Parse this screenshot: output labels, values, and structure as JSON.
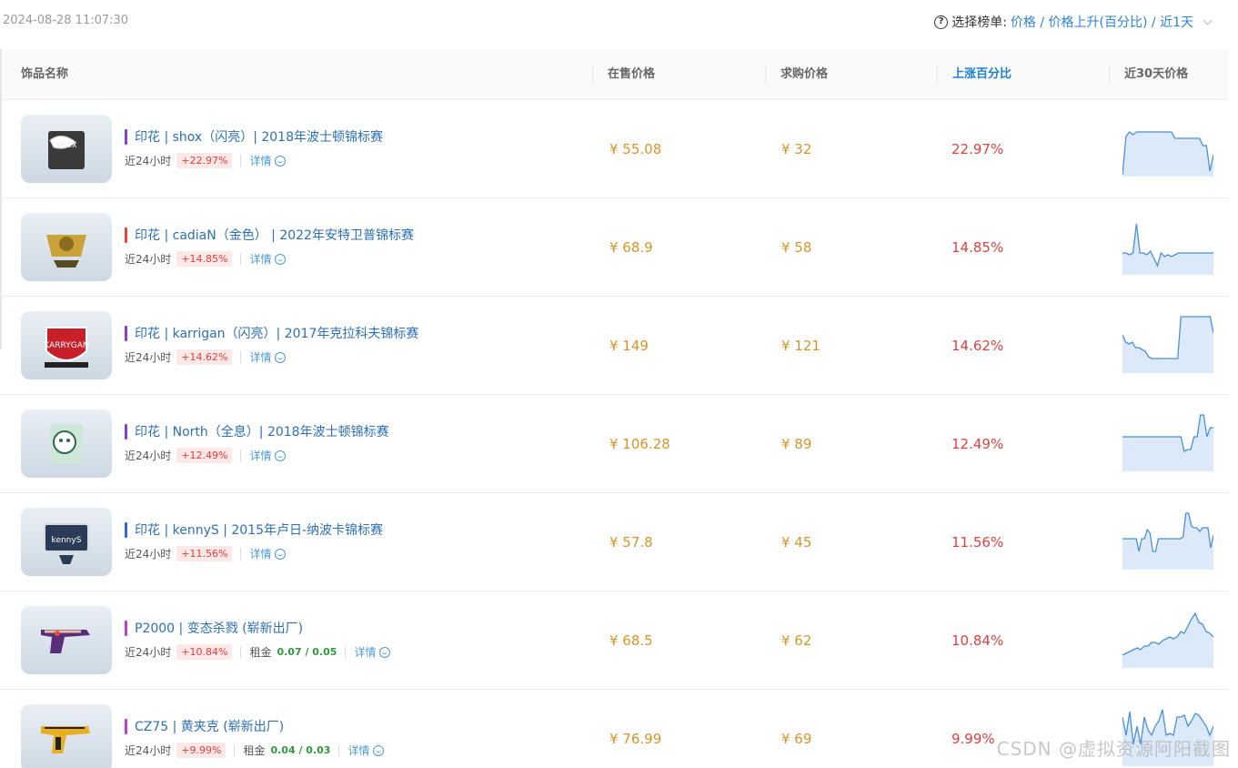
{
  "topbar": {
    "timestamp": "2024-08-28 11:07:30",
    "help_icon": "question-circle-icon",
    "rank_label": "选择榜单:",
    "rank_value": "价格 / 价格上升(百分比) / 近1天"
  },
  "table": {
    "headers": {
      "name": "饰品名称",
      "sell_price": "在售价格",
      "buy_price": "求购价格",
      "rise_pct": "上涨百分比",
      "trend": "近30天价格"
    },
    "period_label": "近24小时",
    "detail_label": "详情",
    "rent_label": "租金",
    "rows": [
      {
        "name": "印花 | shox（闪亮）| 2018年波士顿锦标赛",
        "bar_color": "#8a3fd1",
        "change": "+22.97%",
        "sell": "¥ 55.08",
        "buy": "¥ 32",
        "pct": "22.97%",
        "rent": "",
        "spark": [
          62,
          20,
          15,
          18,
          15,
          15,
          15,
          15,
          15,
          15,
          15,
          15,
          15,
          15,
          15,
          22,
          22,
          22,
          22,
          22,
          22,
          22,
          22,
          30,
          30,
          58,
          40
        ],
        "thumb": "sticker-shox"
      },
      {
        "name": "印花 | cadiaN（金色） | 2022年安特卫普锦标赛",
        "bar_color": "#e04a3a",
        "change": "+14.85%",
        "sell": "¥ 68.9",
        "buy": "¥ 58",
        "pct": "14.85%",
        "rent": "",
        "spark": [
          40,
          40,
          42,
          40,
          8,
          40,
          40,
          42,
          38,
          46,
          54,
          40,
          44,
          42,
          44,
          42,
          40,
          40,
          40,
          40,
          40,
          40,
          40,
          40,
          40,
          40,
          40
        ],
        "thumb": "sticker-cadian"
      },
      {
        "name": "印花 | karrigan（闪亮）| 2017年克拉科夫锦标赛",
        "bar_color": "#8a3fd1",
        "change": "+14.62%",
        "sell": "¥ 149",
        "buy": "¥ 121",
        "pct": "14.62%",
        "rent": "",
        "spark": [
          22,
          30,
          32,
          30,
          36,
          36,
          38,
          40,
          46,
          48,
          48,
          48,
          48,
          48,
          48,
          48,
          48,
          48,
          2,
          2,
          2,
          2,
          2,
          2,
          2,
          2,
          2,
          2,
          20
        ],
        "thumb": "sticker-karrigan"
      },
      {
        "name": "印花 | North（全息）| 2018年波士顿锦标赛",
        "bar_color": "#8a3fd1",
        "change": "+12.49%",
        "sell": "¥ 106.28",
        "buy": "¥ 89",
        "pct": "12.49%",
        "rent": "",
        "spark": [
          26,
          26,
          26,
          26,
          26,
          26,
          26,
          26,
          26,
          26,
          26,
          26,
          26,
          26,
          26,
          26,
          26,
          26,
          26,
          42,
          40,
          40,
          26,
          26,
          2,
          2,
          26,
          16,
          16
        ],
        "thumb": "sticker-north"
      },
      {
        "name": "印花 | kennyS | 2015年卢日-纳波卡锦标赛",
        "bar_color": "#3466d8",
        "change": "+11.56%",
        "sell": "¥ 57.8",
        "buy": "¥ 45",
        "pct": "11.56%",
        "rent": "",
        "spark": [
          30,
          30,
          30,
          30,
          30,
          30,
          44,
          30,
          30,
          20,
          24,
          44,
          44,
          30,
          30,
          30,
          30,
          30,
          30,
          30,
          30,
          30,
          28,
          2,
          2,
          16,
          18,
          18,
          22,
          18,
          18,
          18,
          40,
          26
        ],
        "thumb": "sticker-kennys"
      },
      {
        "name": "P2000 | 变态杀戮 (崭新出厂)",
        "bar_color": "#c23fd6",
        "change": "+10.84%",
        "sell": "¥ 68.5",
        "buy": "¥ 62",
        "pct": "10.84%",
        "rent": "0.07 / 0.05",
        "spark": [
          50,
          48,
          46,
          44,
          42,
          44,
          40,
          40,
          36,
          36,
          38,
          34,
          32,
          30,
          32,
          30,
          24,
          26,
          18,
          10,
          4,
          14,
          16,
          24,
          26,
          30
        ],
        "thumb": "weapon-p2000"
      },
      {
        "name": "CZ75 | 黄夹克 (崭新出厂)",
        "bar_color": "#c23fd6",
        "change": "+9.99%",
        "sell": "¥ 76.99",
        "buy": "¥ 69",
        "pct": "9.99%",
        "rent": "0.04 / 0.03",
        "spark": [
          10,
          30,
          4,
          40,
          20,
          40,
          10,
          24,
          30,
          20,
          14,
          2,
          30,
          28,
          30,
          10,
          10,
          8,
          20,
          14,
          6,
          8,
          14,
          20,
          30,
          20
        ],
        "thumb": "weapon-cz75"
      }
    ]
  },
  "colors": {
    "link": "#2c6fb6",
    "price": "#d8942a",
    "rise": "#e0413f",
    "rent": "#2f9a3b",
    "spark_line": "#4a90d9",
    "spark_fill": "#dbe9f8"
  },
  "watermark": "CSDN @虚拟资源阿阳截图"
}
